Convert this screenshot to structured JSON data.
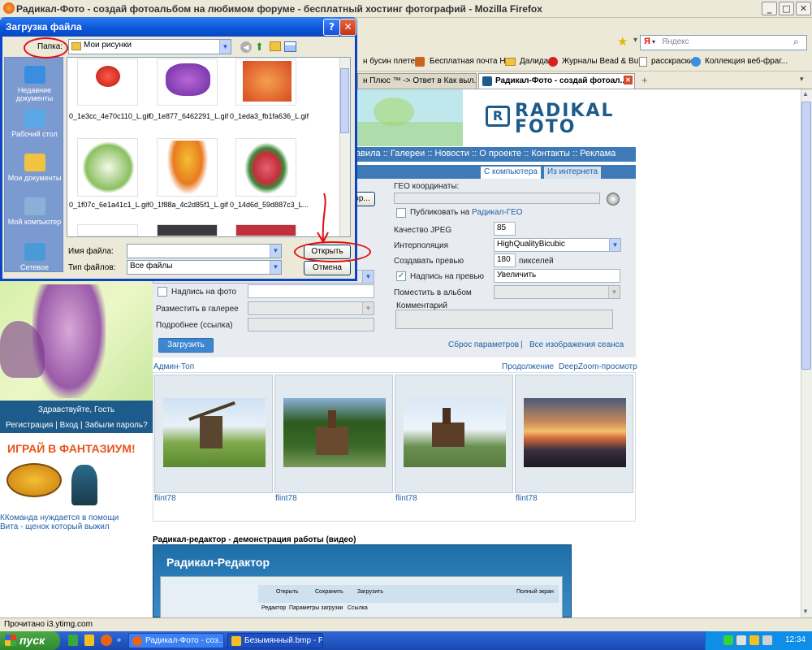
{
  "browser": {
    "title": "Радикал-Фото - создай фотоальбом на любимом форуме - бесплатный хостинг фотографий - Mozilla Firefox",
    "search_placeholder": "Яндекс",
    "search_engine": "Я",
    "bookmarks": [
      "н бусин плете...",
      "Бесплатная почта Н...",
      "Далида",
      "Журналы Bead & But...",
      "расскраски",
      "Коллекция веб-фраг..."
    ],
    "tabs": [
      "н Плюс ™ -> Ответ в Как выл...",
      "Радикал-Фото - создай фотоал..."
    ],
    "status": "Прочитано i3.ytimg.com"
  },
  "site": {
    "logo": "RADIKAL FOTO",
    "nav": "авила :: Галереи :: Новости :: О проекте :: Контакты :: Реклама",
    "upload_tabs": [
      "С компьютера",
      "Из интернета"
    ],
    "browse_button": "ор...",
    "form": {
      "geo_label": "ГЕО координаты:",
      "publish_label": "Публиковать на ",
      "publish_link": "Радикал-ГЕО",
      "jpeg_label": "Качество JPEG",
      "jpeg_value": "85",
      "interp_label": "Интерполяция",
      "interp_value": "HighQualityBicubic",
      "preview_label": "Создавать превью",
      "preview_value": "180",
      "preview_unit": "пикселей",
      "preview_caption_label": "Надпись на превью",
      "preview_caption_value": "Увеличить",
      "album_label": "Поместить в альбом",
      "comment_label": "Комментарий",
      "photo_caption_label": "Надпись на фото",
      "gallery_label": "Разместить в галерее",
      "details_label": "Подробнее (ссылка)",
      "upload_button": "Загрузить",
      "reset_link": "Сброс параметров",
      "separator": "|",
      "session_link": "Все изображения сеанса"
    },
    "admin_top": "Админ-Топ",
    "continue_link": "Продолжение",
    "deepzoom_link": "DeepZoom-просмотр",
    "photos": [
      {
        "author": "flint78"
      },
      {
        "author": "flint78"
      },
      {
        "author": "flint78"
      },
      {
        "author": "flint78"
      }
    ],
    "sidebar": {
      "greeting": "Здравствуйте, Гость",
      "register": "Регистрация",
      "login": "Вход",
      "forgot": "Забыли пароль?",
      "sep": "|",
      "promo": "ИГРАЙ В ФАНТАЗИУМ!",
      "news1": "ККоманда нуждается в помощи",
      "news2": "Вита - щенок который выжил"
    },
    "video_title": "Радикал-редактор - демонстрация работы (видео)",
    "video_caption": "Радикал-Редактор",
    "video_toolbar": [
      "Открыть",
      "Сохранить",
      "Загрузить",
      "Полный экран"
    ],
    "video_tabs": [
      "Редактор",
      "Параметры загрузки",
      "Ссылка"
    ]
  },
  "dialog": {
    "title": "Загрузка файла",
    "folder_label": "Папка:",
    "folder_value": "Мои рисунки",
    "places": [
      "Недавние документы",
      "Рабочий стол",
      "Мои документы",
      "Мой компьютер",
      "Сетевое"
    ],
    "files": [
      "0_1e3cc_4e70c110_L.gif",
      "0_1e877_6462291_L.gif",
      "0_1eda3_fb1fa636_L.gif",
      "0_1f07c_6e1a41c1_L.gif",
      "0_1f88a_4c2d85f1_L.gif",
      "0_14d6d_59d887c3_L..."
    ],
    "filename_label": "Имя файла:",
    "filetype_label": "Тип файлов:",
    "filetype_value": "Все файлы",
    "open_button": "Открыть",
    "cancel_button": "Отмена"
  },
  "taskbar": {
    "start": "пуск",
    "items": [
      "Радикал-Фото - соз...",
      "Безымянный.bmp - Р..."
    ],
    "lang": "RU",
    "time": "12:34"
  }
}
